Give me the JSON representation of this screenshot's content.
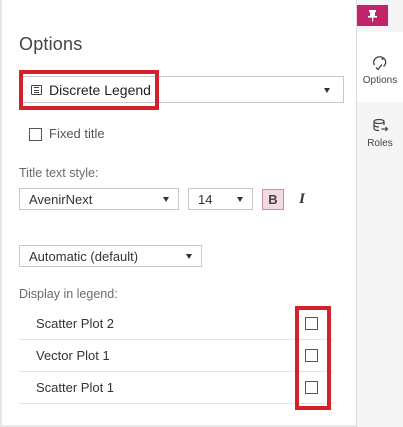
{
  "panel": {
    "title": "Options",
    "legend_type": {
      "value": "Discrete Legend",
      "icon": "legend-icon"
    },
    "fixed_title": {
      "label": "Fixed title",
      "checked": false
    },
    "title_text_style": {
      "label": "Title text style:",
      "font": "AvenirNext",
      "size": "14",
      "bold_label": "B",
      "italic_label": "I",
      "bold_active": true
    },
    "position_select": {
      "value": "Automatic (default)"
    },
    "display_in_legend": {
      "label": "Display in legend:",
      "items": [
        {
          "label": "Scatter Plot 2",
          "checked": false
        },
        {
          "label": "Vector Plot 1",
          "checked": false
        },
        {
          "label": "Scatter Plot 1",
          "checked": false
        }
      ]
    }
  },
  "sidebar": {
    "pin_icon": "pin-icon",
    "tabs": [
      {
        "label": "Options",
        "icon": "options-icon",
        "active": true
      },
      {
        "label": "Roles",
        "icon": "roles-icon",
        "active": false
      }
    ]
  },
  "colors": {
    "accent": "#c0246b",
    "highlight": "#d3202a",
    "bold_bg": "#f3d9e3"
  }
}
